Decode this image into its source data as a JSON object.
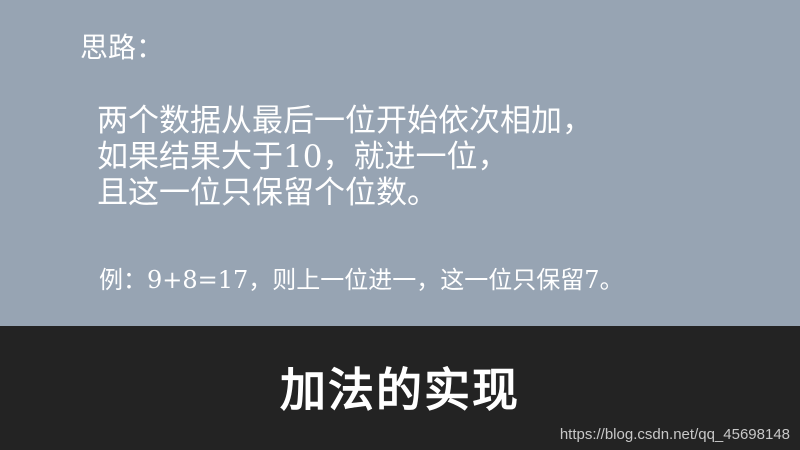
{
  "slide": {
    "heading": "思路：",
    "lines": [
      "两个数据从最后一位开始依次相加，",
      "如果结果大于10，就进一位，",
      "且这一位只保留个位数。"
    ],
    "example": "例：9+8=17，则上一位进一，这一位只保留7。"
  },
  "footer": {
    "title": "加法的实现",
    "watermark": "https://blog.csdn.net/qq_45698148"
  },
  "colors": {
    "content_background": "#97a4b3",
    "footer_background": "#232323",
    "text": "#ffffff",
    "watermark": "#c8c8c8"
  }
}
